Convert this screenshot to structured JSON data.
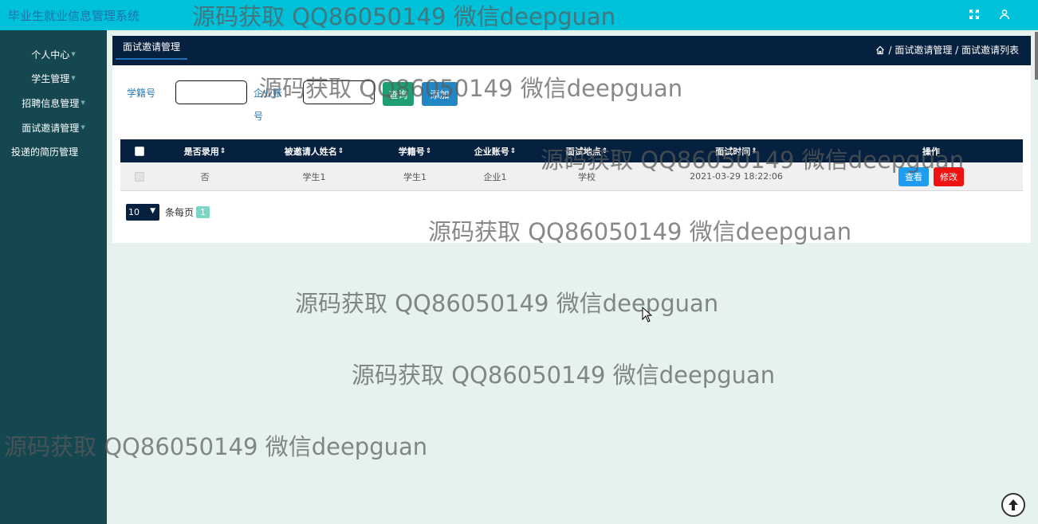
{
  "app": {
    "title": "毕业生就业信息管理系统"
  },
  "topbar": {
    "icons": [
      "fullscreen-icon",
      "user-icon"
    ]
  },
  "sidebar": {
    "items": [
      {
        "label": "个人中心",
        "has_caret": true
      },
      {
        "label": "学生管理",
        "has_caret": true
      },
      {
        "label": "招聘信息管理",
        "has_caret": true
      },
      {
        "label": "面试邀请管理",
        "has_caret": true
      },
      {
        "label": "投递的简历管理",
        "has_caret": false
      }
    ]
  },
  "header": {
    "tab": "面试邀请管理",
    "breadcrumb": "/ 面试邀请管理 / 面试邀请列表"
  },
  "search": {
    "student_label": "学籍号",
    "student_value": "",
    "company_label_1": "企业账",
    "company_label_2": "号",
    "company_value": "",
    "query_button": "查询",
    "add_button": "添加"
  },
  "table": {
    "headers": [
      "是否录用",
      "被邀请人姓名",
      "学籍号",
      "企业账号",
      "面试地点",
      "面试时间",
      "操作"
    ],
    "rows": [
      {
        "hired": "否",
        "invitee_name": "学生1",
        "student_id": "学生1",
        "company_account": "企业1",
        "location": "学校",
        "time": "2021-03-29 18:22:06",
        "view_label": "查看",
        "edit_label": "修改"
      }
    ]
  },
  "pagination": {
    "page_size": "10",
    "per_page_label": "条每页",
    "current_page": "1"
  },
  "watermark": {
    "text": "源码获取 QQ86050149 微信deepguan"
  },
  "colors": {
    "topbar": "#00c1da",
    "sidebar": "#14474f",
    "header": "#06203f",
    "background": "#e6f2ee",
    "query_button": "#1f9e72",
    "add_button": "#2186c4",
    "view_button": "#1e9cf0",
    "edit_button": "#ee1212"
  }
}
